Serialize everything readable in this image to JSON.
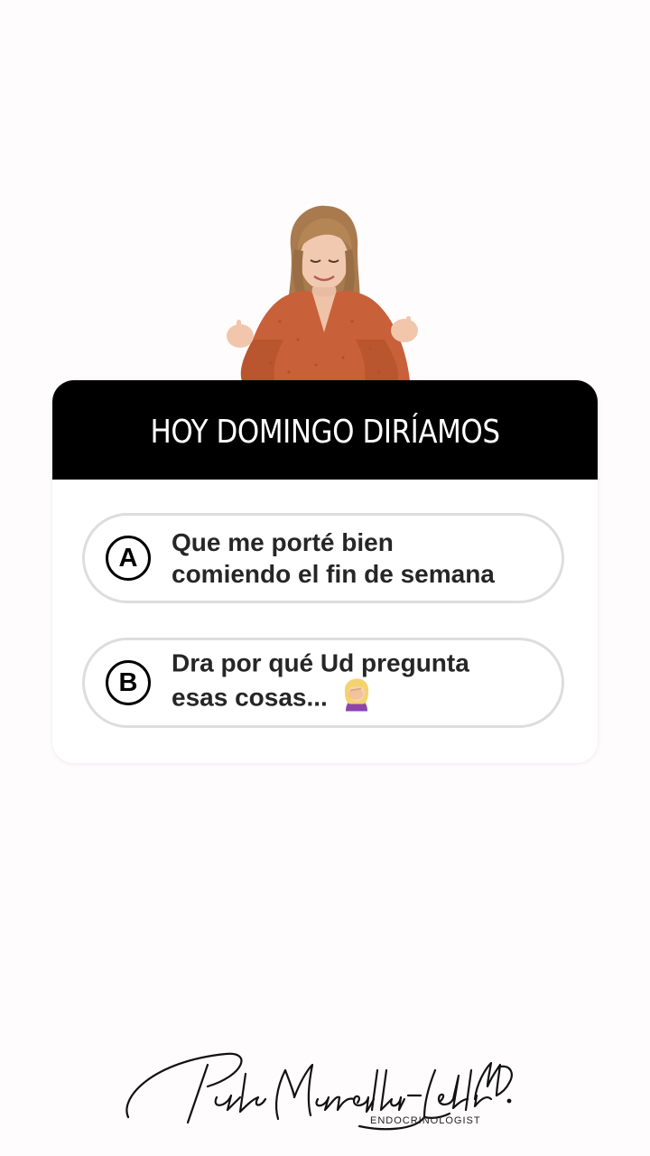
{
  "poll": {
    "title": "HOY DOMINGO DIRÍAMOS",
    "options": [
      {
        "letter": "A",
        "line1": "Que me porté bien",
        "line2": "comiendo el fin de semana"
      },
      {
        "letter": "B",
        "line1": "Dra por qué Ud pregunta",
        "line2": "esas cosas...",
        "emoji": "woman-facepalming-emoji"
      }
    ]
  },
  "signature": {
    "name": "Paola Mansilla-Letelier MD.",
    "subtitle": "ENDOCRINOLOGIST"
  },
  "colors": {
    "background": "#fefcfd",
    "header": "#000000",
    "blouse": "#c8603a",
    "hair": "#a77a4f",
    "option_border": "#dddddd",
    "option_text": "#262626"
  }
}
